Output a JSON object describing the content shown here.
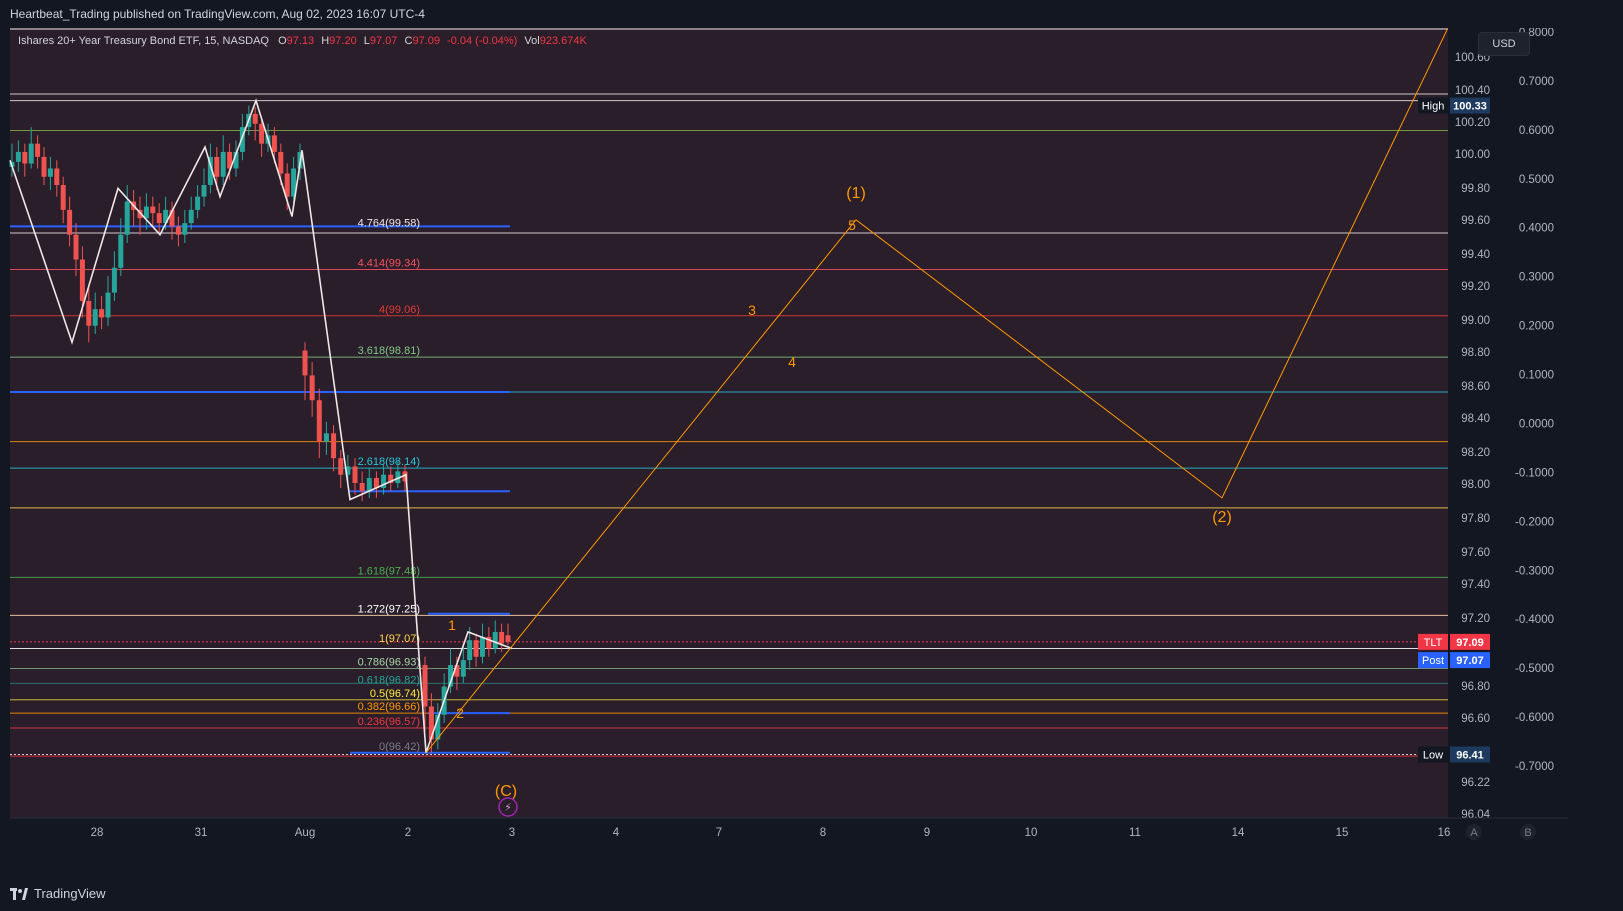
{
  "header": {
    "published": "Heartbeat_Trading published on TradingView.com, Aug 02, 2023 16:07 UTC-4"
  },
  "legend": {
    "symbol": "Ishares 20+ Year Treasury Bond ETF, 15, NASDAQ",
    "open_label": "O",
    "open": "97.13",
    "high_label": "H",
    "high": "97.20",
    "low_label": "L",
    "low": "97.07",
    "close_label": "C",
    "close": "97.09",
    "change": "-0.04 (-0.04%)",
    "vol_label": "Vol",
    "vol": "923.674K"
  },
  "currency_button": "USD",
  "footer": {
    "brand": "TradingView"
  },
  "bottom_axis_buttons": [
    "A",
    "B"
  ],
  "badges": {
    "high": {
      "label": "High",
      "value": "100.33"
    },
    "tlt": {
      "label": "TLT",
      "value": "97.09"
    },
    "post": {
      "label": "Post",
      "value": "97.07"
    },
    "low": {
      "label": "Low",
      "value": "96.41"
    }
  },
  "colors": {
    "background": "#2a1e2a",
    "bullish": "#26a69a",
    "bearish": "#ef5350",
    "wave": "#ff9800",
    "zigzag": "#f0e6e6",
    "blue_line": "#2962ff"
  },
  "chart_data": {
    "type": "candlestick",
    "y_axis_left_range": [
      96.04,
      100.8
    ],
    "y_axis_right_range": [
      -0.8,
      0.8
    ],
    "y_ticks_left": [
      "100.60",
      "100.40",
      "100.20",
      "100.00",
      "99.80",
      "99.60",
      "99.40",
      "99.20",
      "99.00",
      "98.80",
      "98.60",
      "98.40",
      "98.20",
      "98.00",
      "97.80",
      "97.60",
      "97.40",
      "97.20",
      "96.80",
      "96.60",
      "96.22",
      "96.04"
    ],
    "y_ticks_right": [
      "0.8000",
      "0.7000",
      "0.6000",
      "0.5000",
      "0.4000",
      "0.3000",
      "0.2000",
      "0.1000",
      "0.0000",
      "-0.1000",
      "-0.2000",
      "-0.3000",
      "-0.4000",
      "-0.5000",
      "-0.6000",
      "-0.7000"
    ],
    "x_ticks": [
      "28",
      "31",
      "Aug",
      "2",
      "3",
      "4",
      "7",
      "8",
      "9",
      "10",
      "11",
      "14",
      "15",
      "16"
    ],
    "fib_levels": [
      {
        "label": "4.764(99.58)",
        "price": 99.58,
        "color": "#f0e6e6"
      },
      {
        "label": "4.414(99.34)",
        "price": 99.34,
        "color": "#f7525f"
      },
      {
        "label": "4(99.06)",
        "price": 99.06,
        "color": "#e53935"
      },
      {
        "label": "3.618(98.81)",
        "price": 98.81,
        "color": "#81c784"
      },
      {
        "label": "2.618(98.14)",
        "price": 98.14,
        "color": "#26c6da"
      },
      {
        "label": "1.618(97.48)",
        "price": 97.48,
        "color": "#4caf50"
      },
      {
        "label": "1.272(97.25)",
        "price": 97.25,
        "color": "#ffffff"
      },
      {
        "label": "1(97.07)",
        "price": 97.07,
        "color": "#ffd54f"
      },
      {
        "label": "0.786(96.93)",
        "price": 96.93,
        "color": "#a5d6a7"
      },
      {
        "label": "0.618(96.82)",
        "price": 96.82,
        "color": "#26a69a"
      },
      {
        "label": "0.5(96.74)",
        "price": 96.74,
        "color": "#ffeb3b"
      },
      {
        "label": "0.382(96.66)",
        "price": 96.66,
        "color": "#ff9800"
      },
      {
        "label": "0.236(96.57)",
        "price": 96.57,
        "color": "#f23645"
      },
      {
        "label": "0(96.42)",
        "price": 96.42,
        "color": "#787b86"
      }
    ],
    "wave_labels": [
      "(1)",
      "5",
      "3",
      "4",
      "(2)",
      "1",
      "2",
      "(C)"
    ],
    "projection": [
      {
        "date": "Aug 2",
        "price": 96.42
      },
      {
        "date": "Aug 8",
        "price": 99.64
      },
      {
        "date": "Aug 14",
        "price": 97.96
      },
      {
        "date": "Aug 16",
        "price": 100.8
      }
    ],
    "candles": [
      [
        99.96,
        99.99,
        100.1,
        99.9
      ],
      [
        99.99,
        100.05,
        100.12,
        99.93
      ],
      [
        100.05,
        99.98,
        100.1,
        99.9
      ],
      [
        99.98,
        100.1,
        100.2,
        99.95
      ],
      [
        100.1,
        100.02,
        100.15,
        99.95
      ],
      [
        100.02,
        99.9,
        100.08,
        99.85
      ],
      [
        99.9,
        99.95,
        100.02,
        99.82
      ],
      [
        99.95,
        99.85,
        100.0,
        99.78
      ],
      [
        99.85,
        99.7,
        99.9,
        99.62
      ],
      [
        99.7,
        99.55,
        99.78,
        99.48
      ],
      [
        99.55,
        99.4,
        99.62,
        99.3
      ],
      [
        99.4,
        99.15,
        99.48,
        99.05
      ],
      [
        99.15,
        99.0,
        99.25,
        98.9
      ],
      [
        99.0,
        99.1,
        99.2,
        98.95
      ],
      [
        99.1,
        99.05,
        99.18,
        98.98
      ],
      [
        99.05,
        99.2,
        99.3,
        99.0
      ],
      [
        99.2,
        99.35,
        99.45,
        99.15
      ],
      [
        99.35,
        99.55,
        99.65,
        99.3
      ],
      [
        99.55,
        99.75,
        99.85,
        99.5
      ],
      [
        99.75,
        99.7,
        99.82,
        99.6
      ],
      [
        99.7,
        99.65,
        99.78,
        99.55
      ],
      [
        99.65,
        99.72,
        99.8,
        99.58
      ],
      [
        99.72,
        99.68,
        99.78,
        99.6
      ],
      [
        99.68,
        99.62,
        99.74,
        99.55
      ],
      [
        99.62,
        99.7,
        99.78,
        99.58
      ],
      [
        99.7,
        99.6,
        99.75,
        99.52
      ],
      [
        99.6,
        99.55,
        99.66,
        99.48
      ],
      [
        99.55,
        99.62,
        99.7,
        99.5
      ],
      [
        99.62,
        99.7,
        99.78,
        99.58
      ],
      [
        99.7,
        99.78,
        99.85,
        99.65
      ],
      [
        99.78,
        99.85,
        99.95,
        99.72
      ],
      [
        99.85,
        100.02,
        100.1,
        99.8
      ],
      [
        100.02,
        99.9,
        100.08,
        99.82
      ],
      [
        99.9,
        100.05,
        100.15,
        99.85
      ],
      [
        100.05,
        99.95,
        100.1,
        99.88
      ],
      [
        99.95,
        100.05,
        100.12,
        99.9
      ],
      [
        100.05,
        100.2,
        100.28,
        100.0
      ],
      [
        100.2,
        100.28,
        100.33,
        100.15
      ],
      [
        100.28,
        100.22,
        100.32,
        100.12
      ],
      [
        100.22,
        100.1,
        100.26,
        100.02
      ],
      [
        100.1,
        100.15,
        100.22,
        100.05
      ],
      [
        100.15,
        100.05,
        100.2,
        99.98
      ],
      [
        100.05,
        99.92,
        100.1,
        99.85
      ],
      [
        99.92,
        99.78,
        99.98,
        99.7
      ],
      [
        99.78,
        99.95,
        100.02,
        99.72
      ],
      [
        99.95,
        100.05,
        100.1,
        99.88
      ],
      [
        98.85,
        98.7,
        98.9,
        98.55
      ],
      [
        98.7,
        98.55,
        98.78,
        98.45
      ],
      [
        98.55,
        98.3,
        98.62,
        98.2
      ],
      [
        98.3,
        98.35,
        98.42,
        98.22
      ],
      [
        98.35,
        98.2,
        98.4,
        98.12
      ],
      [
        98.2,
        98.1,
        98.25,
        98.02
      ],
      [
        98.1,
        98.15,
        98.22,
        98.05
      ],
      [
        98.15,
        98.05,
        98.2,
        97.98
      ],
      [
        98.05,
        98.0,
        98.12,
        97.94
      ],
      [
        98.0,
        98.08,
        98.14,
        97.96
      ],
      [
        98.08,
        98.02,
        98.12,
        97.96
      ],
      [
        98.02,
        98.1,
        98.16,
        97.98
      ],
      [
        98.1,
        98.05,
        98.15,
        98.0
      ],
      [
        98.05,
        98.12,
        98.18,
        98.02
      ],
      [
        98.12,
        98.06,
        98.16,
        98.0
      ],
      [
        96.95,
        96.7,
        97.0,
        96.55
      ],
      [
        96.7,
        96.5,
        96.78,
        96.42
      ],
      [
        96.5,
        96.65,
        96.72,
        96.44
      ],
      [
        96.65,
        96.82,
        96.9,
        96.6
      ],
      [
        96.82,
        96.95,
        97.05,
        96.78
      ],
      [
        96.95,
        96.88,
        97.0,
        96.8
      ],
      [
        96.88,
        96.98,
        97.08,
        96.84
      ],
      [
        96.98,
        97.1,
        97.18,
        96.92
      ],
      [
        97.1,
        97.0,
        97.14,
        96.94
      ],
      [
        97.0,
        97.12,
        97.2,
        96.96
      ],
      [
        97.12,
        97.05,
        97.18,
        97.0
      ],
      [
        97.05,
        97.15,
        97.22,
        97.02
      ],
      [
        97.15,
        97.08,
        97.2,
        97.03
      ],
      [
        97.13,
        97.09,
        97.2,
        97.07
      ]
    ]
  }
}
